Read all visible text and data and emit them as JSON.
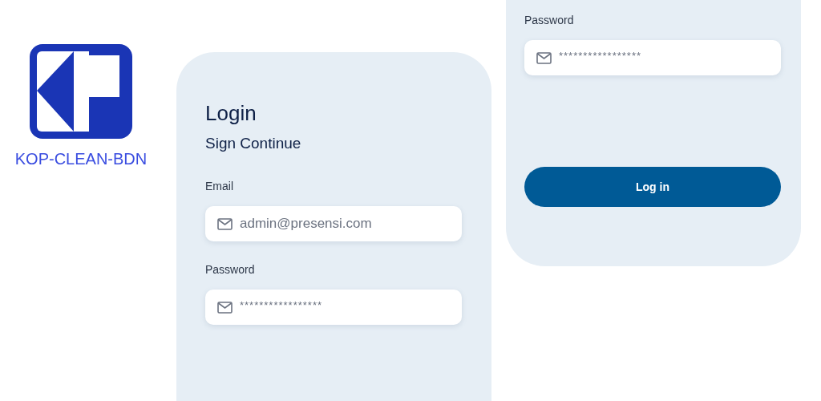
{
  "logo": {
    "caption": "KOP-CLEAN-BDN"
  },
  "login_card": {
    "title": "Login",
    "subtitle": "Sign Continue",
    "fields": [
      {
        "label": "Email",
        "value": "admin@presensi.com",
        "kind": "text"
      },
      {
        "label": "Password",
        "value": "*****************",
        "kind": "secret"
      }
    ]
  },
  "side_card": {
    "fields": [
      {
        "label": "Password",
        "value": "*****************",
        "kind": "secret"
      }
    ],
    "button": "Log in"
  }
}
